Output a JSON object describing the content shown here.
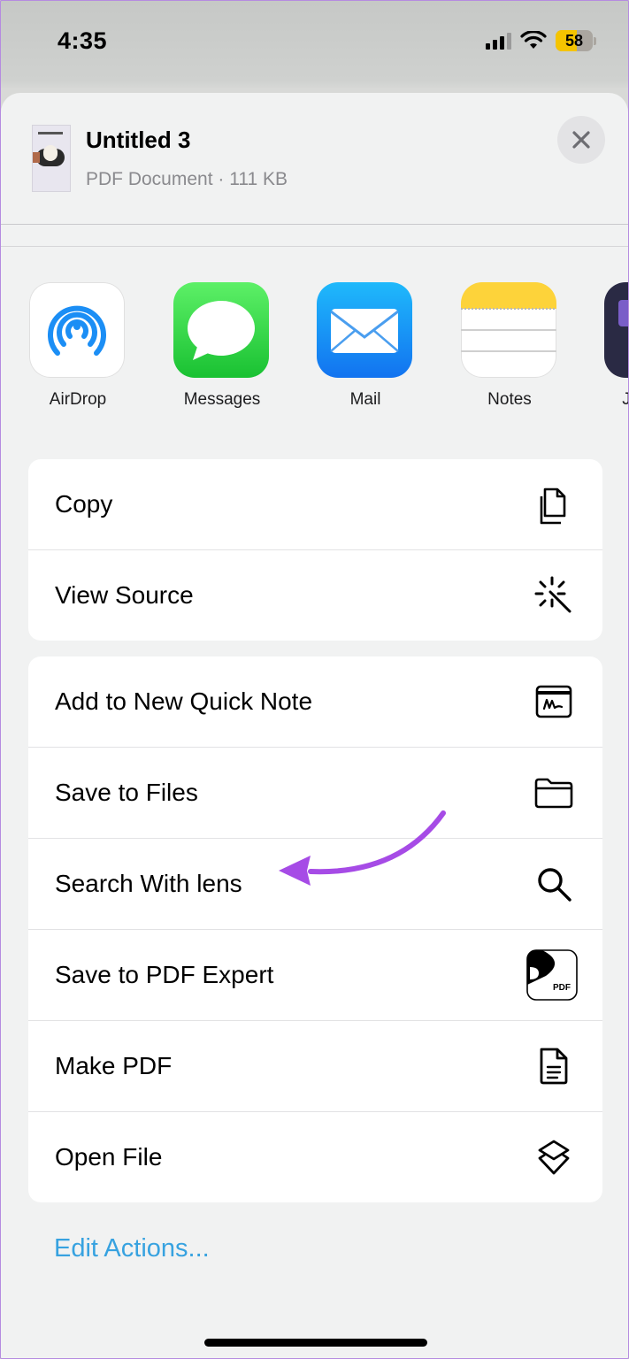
{
  "status_bar": {
    "time": "4:35",
    "battery": "58",
    "battery_level": 0.58
  },
  "document": {
    "title": "Untitled 3",
    "subtitle": "PDF Document · 111 KB"
  },
  "apps": [
    {
      "label": "AirDrop",
      "icon": "airdrop-icon"
    },
    {
      "label": "Messages",
      "icon": "messages-icon"
    },
    {
      "label": "Mail",
      "icon": "mail-icon"
    },
    {
      "label": "Notes",
      "icon": "notes-icon"
    },
    {
      "label": "J",
      "icon": "app-icon"
    }
  ],
  "actions_group1": [
    {
      "label": "Copy",
      "icon": "copy-icon"
    },
    {
      "label": "View Source",
      "icon": "magic-wand-icon"
    }
  ],
  "actions_group2": [
    {
      "label": "Add to New Quick Note",
      "icon": "quick-note-icon"
    },
    {
      "label": "Save to Files",
      "icon": "folder-icon"
    },
    {
      "label": "Search With lens",
      "icon": "search-icon"
    },
    {
      "label": "Save to PDF Expert",
      "icon": "pdf-expert-icon",
      "icon_text": "PDF"
    },
    {
      "label": "Make PDF",
      "icon": "document-icon"
    },
    {
      "label": "Open File",
      "icon": "layers-icon"
    }
  ],
  "edit_actions": "Edit Actions...",
  "colors": {
    "accent": "#37a2e0",
    "annotation": "#a64be6",
    "battery": "#f5c400"
  }
}
